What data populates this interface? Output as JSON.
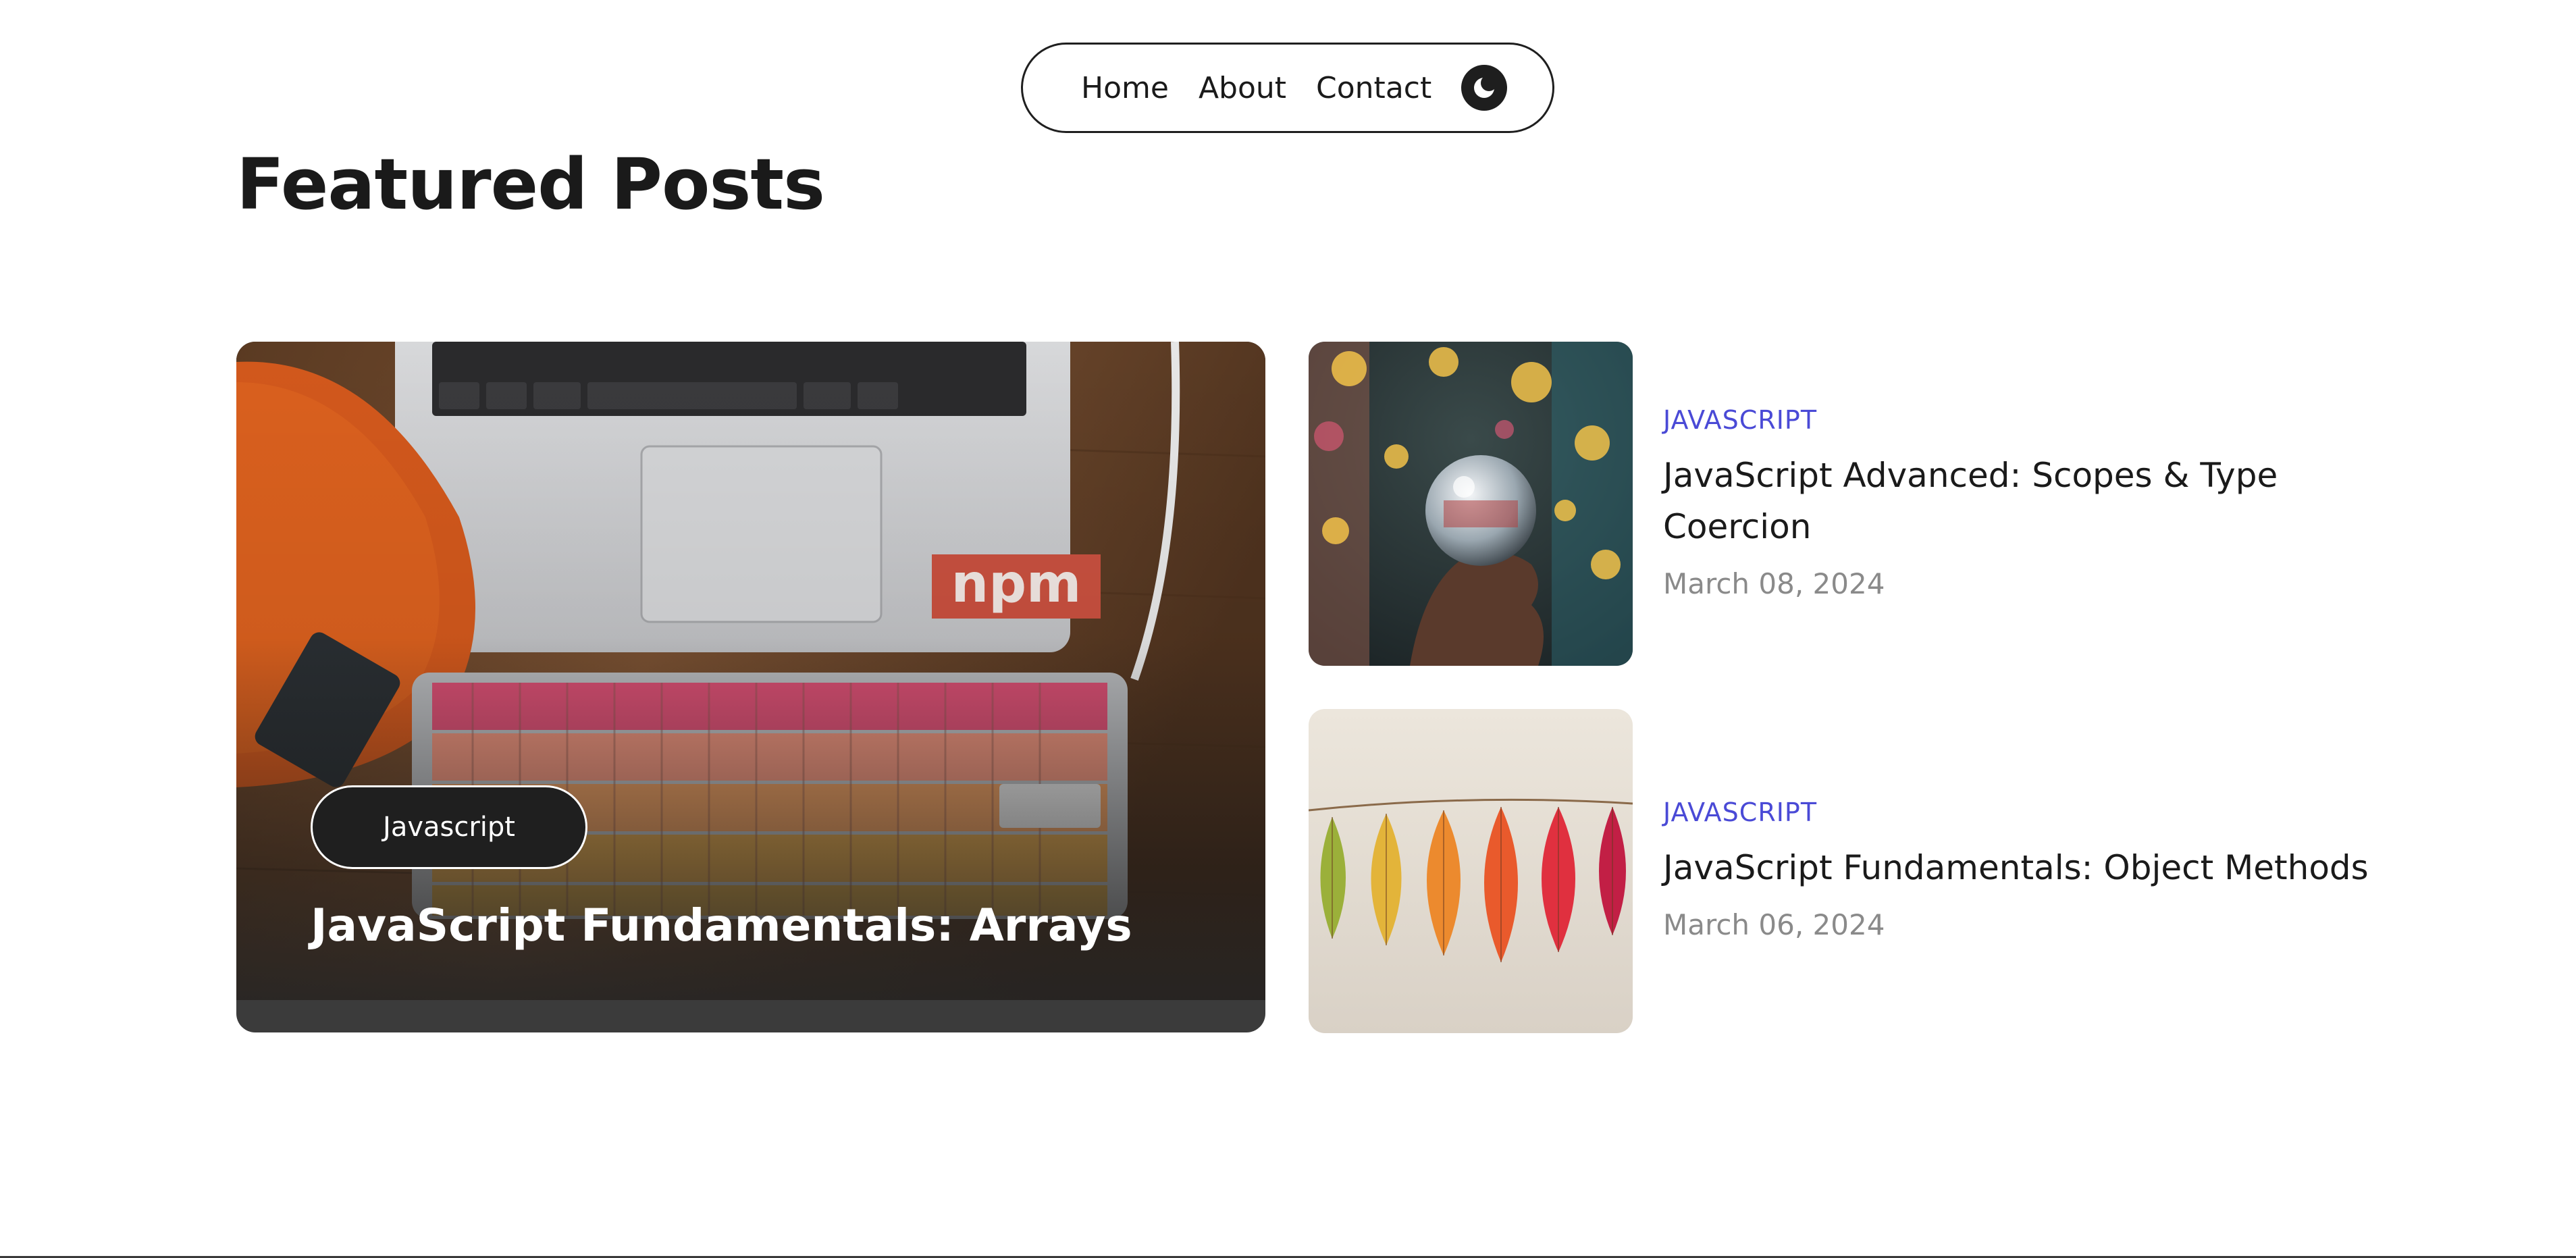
{
  "nav": {
    "items": [
      {
        "label": "Home"
      },
      {
        "label": "About"
      },
      {
        "label": "Contact"
      }
    ],
    "theme_toggle_icon": "moon-icon"
  },
  "page": {
    "heading": "Featured Posts"
  },
  "featured": {
    "badge": "Javascript",
    "title": "JavaScript Fundamentals: Arrays",
    "image_icon": "laptop-keyboard-photo"
  },
  "posts": [
    {
      "category": "JAVASCRIPT",
      "title": "JavaScript Advanced: Scopes & Type Coercion",
      "date": "March 08, 2024",
      "image_icon": "crystal-ball-photo"
    },
    {
      "category": "JAVASCRIPT",
      "title": "JavaScript Fundamentals: Object Methods",
      "date": "March 06, 2024",
      "image_icon": "autumn-leaves-photo"
    }
  ],
  "colors": {
    "accent": "#4a4ad6",
    "date": "#8a8a8a",
    "dark": "#1f1f1f"
  }
}
